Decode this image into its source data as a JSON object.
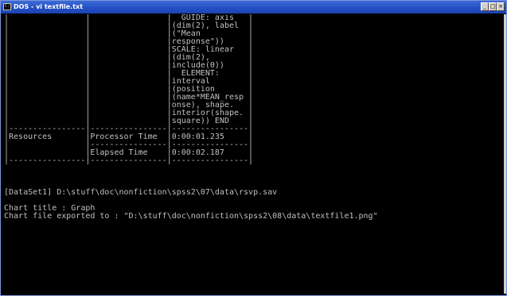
{
  "window": {
    "title": "DOS - vi textfile.txt",
    "icon_text": "C:\\",
    "controls": {
      "minimize": "_",
      "maximize": "□",
      "close": "×"
    }
  },
  "console": {
    "lines": [
      "|                |                |  GUIDE: axis   |",
      "|                |                |(dim(2), label  |",
      "|                |                |(\"Mean          |",
      "|                |                |response\"))     |",
      "|                |                |SCALE: linear   |",
      "|                |                |(dim(2),        |",
      "|                |                |include(0))     |",
      "|                |                |  ELEMENT:      |",
      "|                |                |interval        |",
      "|                |                |(position       |",
      "|                |                |(name*MEAN_resp |",
      "|                |                |onse), shape.   |",
      "|                |                |interior(shape. |",
      "|                |                |square)) END    |",
      "|----------------|----------------|----------------|",
      "|Resources       |Processor Time  |0:00:01.235     |",
      "|                |----------------|----------------|",
      "|                |Elapsed Time    |0:00:02.187     |",
      "|----------------|----------------|----------------|",
      "",
      "",
      "",
      "[DataSet1] D:\\stuff\\doc\\nonfiction\\spss2\\07\\data\\rsvp.sav",
      "",
      "Chart title : Graph",
      "Chart file exported to : \"D:\\stuff\\doc\\nonfiction\\spss2\\08\\data\\textfile1.png\""
    ]
  }
}
